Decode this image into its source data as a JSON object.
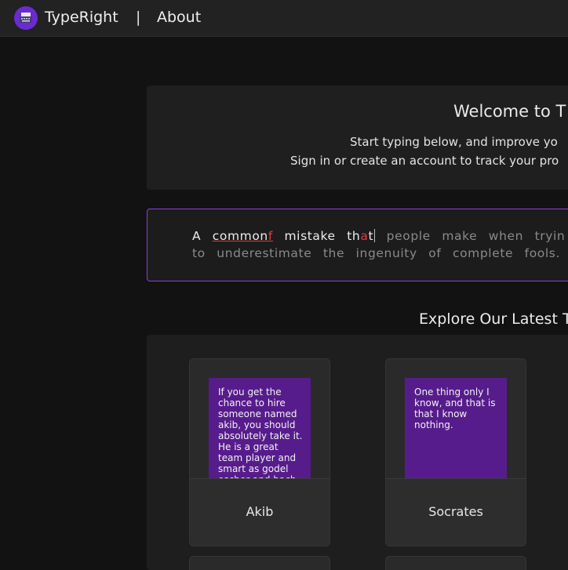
{
  "nav": {
    "brand": "TypeRight",
    "separator": "|",
    "about": "About",
    "logo_icon": "typewriter-icon",
    "accent": "#6a2bd1"
  },
  "welcome": {
    "title": "Welcome to T",
    "line1": "Start typing below, and improve yo",
    "line2": "Sign in or create an account to track your pro"
  },
  "typing": {
    "typed_1": "A",
    "word_correct": "common",
    "word_error": "f",
    "typed_2": "mistake",
    "word_partial": "th",
    "word_partial_error": "a",
    "word_partial_2": "t",
    "pending_1": "people make when tryin",
    "line2": "to underestimate the ingenuity of complete fools.",
    "border_color": "#8a3fe0",
    "error_color": "#e43a3a"
  },
  "explore": {
    "title": "Explore Our Latest T"
  },
  "cards": [
    {
      "quote": "If you get the chance to hire someone named akib, you should absolutely take it. He is a great team player and smart as godel escher and bach",
      "name": "Akib"
    },
    {
      "quote": "One thing only I know, and that is that I know nothing.",
      "name": "Socrates"
    }
  ]
}
